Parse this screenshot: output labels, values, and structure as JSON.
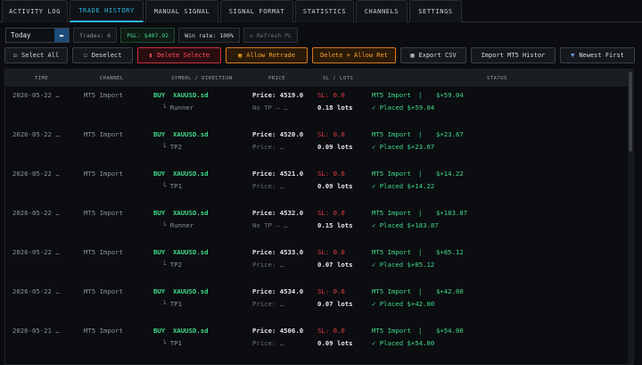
{
  "tabs": [
    {
      "label": "ACTIVITY LOG"
    },
    {
      "label": "TRADE HISTORY"
    },
    {
      "label": "MANUAL SIGNAL"
    },
    {
      "label": "SIGNAL FORMAT"
    },
    {
      "label": "STATISTICS"
    },
    {
      "label": "CHANNELS"
    },
    {
      "label": "SETTINGS"
    }
  ],
  "filters": {
    "period": "Today",
    "trades": "Trades: 6",
    "pnl": "P&L: $407.92",
    "win_rate": "Win rate: 100%",
    "refresh": "↻ Refresh PL"
  },
  "actions": {
    "select_all": "Select All",
    "deselect": "Deselect",
    "delete_selected": "Delete Selecte",
    "allow_retrade": "Allow Retrade",
    "delete_allow": "Delete + Allow Ret",
    "export_csv": "Export CSV",
    "import_mt5": "Import MT5 Histor",
    "newest_first": "Newest First"
  },
  "columns": {
    "time": "TIME",
    "channel": "CHANNEL",
    "symbol": "SYMBOL / DIRECTION",
    "price": "PRICE",
    "sl": "SL / LOTS",
    "status": "STATUS"
  },
  "trades": [
    {
      "time": "2026-05-22 …",
      "channel": "MT5 Import",
      "side": "BUY",
      "symbol": "XAUUSD.sd",
      "sub": "└ Runner",
      "price": "Price: 4519.0",
      "subprice": "No TP — …",
      "sl": "SL: 0.0",
      "lots": "0.18 lots",
      "status_src": "MT5 Import",
      "status_sep": "|",
      "status_pl": "$+59.04",
      "status2": "✓ Placed  $+59.04"
    },
    {
      "time": "2026-05-22 …",
      "channel": "MT5 Import",
      "side": "BUY",
      "symbol": "XAUUSD.sd",
      "sub": "└ TP2",
      "price": "Price: 4520.0",
      "subprice": "Price: …",
      "sl": "SL: 0.0",
      "lots": "0.09 lots",
      "status_src": "MT5 Import",
      "status_sep": "|",
      "status_pl": "$+23.67",
      "status2": "✓ Placed  $+23.67"
    },
    {
      "time": "2026-05-22 …",
      "channel": "MT5 Import",
      "side": "BUY",
      "symbol": "XAUUSD.sd",
      "sub": "└ TP1",
      "price": "Price: 4521.0",
      "subprice": "Price: …",
      "sl": "SL: 0.0",
      "lots": "0.09 lots",
      "status_src": "MT5 Import",
      "status_sep": "|",
      "status_pl": "$+14.22",
      "status2": "✓ Placed  $+14.22"
    },
    {
      "time": "2026-05-22 …",
      "channel": "MT5 Import",
      "side": "BUY",
      "symbol": "XAUUSD.sd",
      "sub": "└ Runner",
      "price": "Price: 4532.0",
      "subprice": "No TP — …",
      "sl": "SL: 0.0",
      "lots": "0.15 lots",
      "status_src": "MT5 Import",
      "status_sep": "|",
      "status_pl": "$+183.87",
      "status2": "✓ Placed  $+183.87"
    },
    {
      "time": "2026-05-22 …",
      "channel": "MT5 Import",
      "side": "BUY",
      "symbol": "XAUUSD.sd",
      "sub": "└ TP2",
      "price": "Price: 4533.0",
      "subprice": "Price: …",
      "sl": "SL: 0.0",
      "lots": "0.07 lots",
      "status_src": "MT5 Import",
      "status_sep": "|",
      "status_pl": "$+85.12",
      "status2": "✓ Placed  $+85.12"
    },
    {
      "time": "2026-05-22 …",
      "channel": "MT5 Import",
      "side": "BUY",
      "symbol": "XAUUSD.sd",
      "sub": "└ TP1",
      "price": "Price: 4534.0",
      "subprice": "Price: …",
      "sl": "SL: 0.0",
      "lots": "0.07 lots",
      "status_src": "MT5 Import",
      "status_sep": "|",
      "status_pl": "$+42.00",
      "status2": "✓ Placed  $+42.00"
    },
    {
      "time": "2026-05-21 …",
      "channel": "MT5 Import",
      "side": "BUY",
      "symbol": "XAUUSD.sd",
      "sub": "└ TP1",
      "price": "Price: 4506.0",
      "subprice": "Price: …",
      "sl": "SL: 0.0",
      "lots": "0.09 lots",
      "status_src": "MT5 Import",
      "status_sep": "|",
      "status_pl": "$+54.00",
      "status2": "✓ Placed  $+54.00"
    }
  ],
  "colors": {
    "accent": "#2fb6e8",
    "positive": "#3fd98a",
    "negative": "#e53946",
    "warning": "#f5a233"
  }
}
